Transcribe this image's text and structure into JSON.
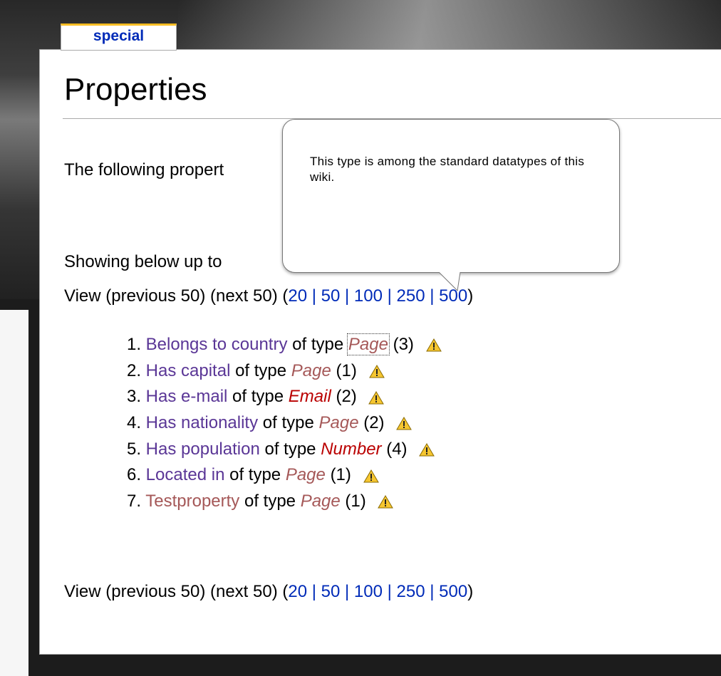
{
  "tab": {
    "label": "special"
  },
  "page": {
    "title": "Properties"
  },
  "intro": {
    "text": "The following propert"
  },
  "showing": {
    "text": "Showing below up to"
  },
  "pager_top": {
    "prefix": "View (previous 50) (next 50) (",
    "sizes": [
      "20",
      "50",
      "100",
      "250",
      "500"
    ],
    "separator": "|",
    "suffix": ")"
  },
  "pager_bottom": {
    "prefix": "View (previous 50) (next 50) (",
    "sizes": [
      "20",
      "50",
      "100",
      "250",
      "500"
    ],
    "separator": "|",
    "suffix": ")"
  },
  "connector": "of type",
  "properties": [
    {
      "num": "1.",
      "name": "Belongs to country",
      "type": "Page",
      "count": "(3)"
    },
    {
      "num": "2.",
      "name": "Has capital",
      "type": "Page",
      "count": "(1)"
    },
    {
      "num": "3.",
      "name": "Has e-mail",
      "type": "Email",
      "count": "(2)"
    },
    {
      "num": "4.",
      "name": "Has nationality",
      "type": "Page",
      "count": "(2)"
    },
    {
      "num": "5.",
      "name": "Has population",
      "type": "Number",
      "count": "(4)"
    },
    {
      "num": "6.",
      "name": "Located in",
      "type": "Page",
      "count": "(1)"
    },
    {
      "num": "7.",
      "name": "Testproperty",
      "type": "Page",
      "count": "(1)"
    }
  ],
  "tooltip": {
    "text": "This type is among the standard datatypes of this wiki."
  },
  "colors": {
    "link": "#002bb8",
    "visited_link": "#5a3696",
    "new_link": "#ba0000",
    "tab_accent": "#fabd23"
  },
  "icons": {
    "warning": "warning-triangle-icon"
  }
}
